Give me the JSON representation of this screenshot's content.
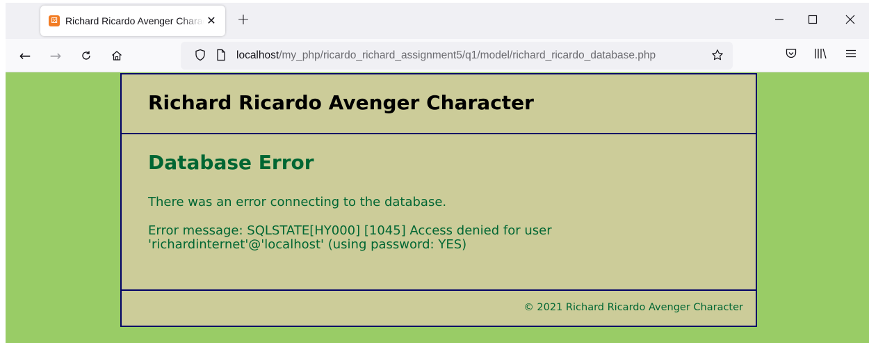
{
  "browser": {
    "tab": {
      "title": "Richard Ricardo Avenger Character",
      "close_glyph": "✕",
      "favicon": "xampp-icon"
    },
    "new_tab_glyph": "+",
    "window_controls": {
      "minimize": "—",
      "maximize": "☐",
      "close": "✕"
    },
    "nav": {
      "back": "←",
      "forward": "→",
      "reload": "C",
      "home": "⌂"
    },
    "url": {
      "host": "localhost",
      "path": "/my_php/ricardo_richard_assignment5/q1/model/richard_ricardo_database.php"
    },
    "icons": {
      "tracking_protection": "shield-icon",
      "page_info": "page-icon",
      "bookmark": "star-icon",
      "pocket": "pocket-icon",
      "library": "library-icon",
      "menu": "hamburger-menu-icon"
    },
    "glyphs": {
      "shield": "⛉",
      "page": "🗋",
      "star": "☆",
      "pocket": "◡",
      "library": "|||\\",
      "menu": "≡"
    }
  },
  "page": {
    "header_title": "Richard Ricardo Avenger Character",
    "heading": "Database Error",
    "message": "There was an error connecting to the database.",
    "error_message": "Error message: SQLSTATE[HY000] [1045] Access denied for user 'richardinternet'@'localhost' (using password: YES)",
    "footer": "© 2021 Richard Ricardo Avenger Character"
  },
  "colors": {
    "viewport_background": "#99cc66",
    "page_background": "#cccc99",
    "border": "#000066",
    "heading_text": "#006633"
  }
}
